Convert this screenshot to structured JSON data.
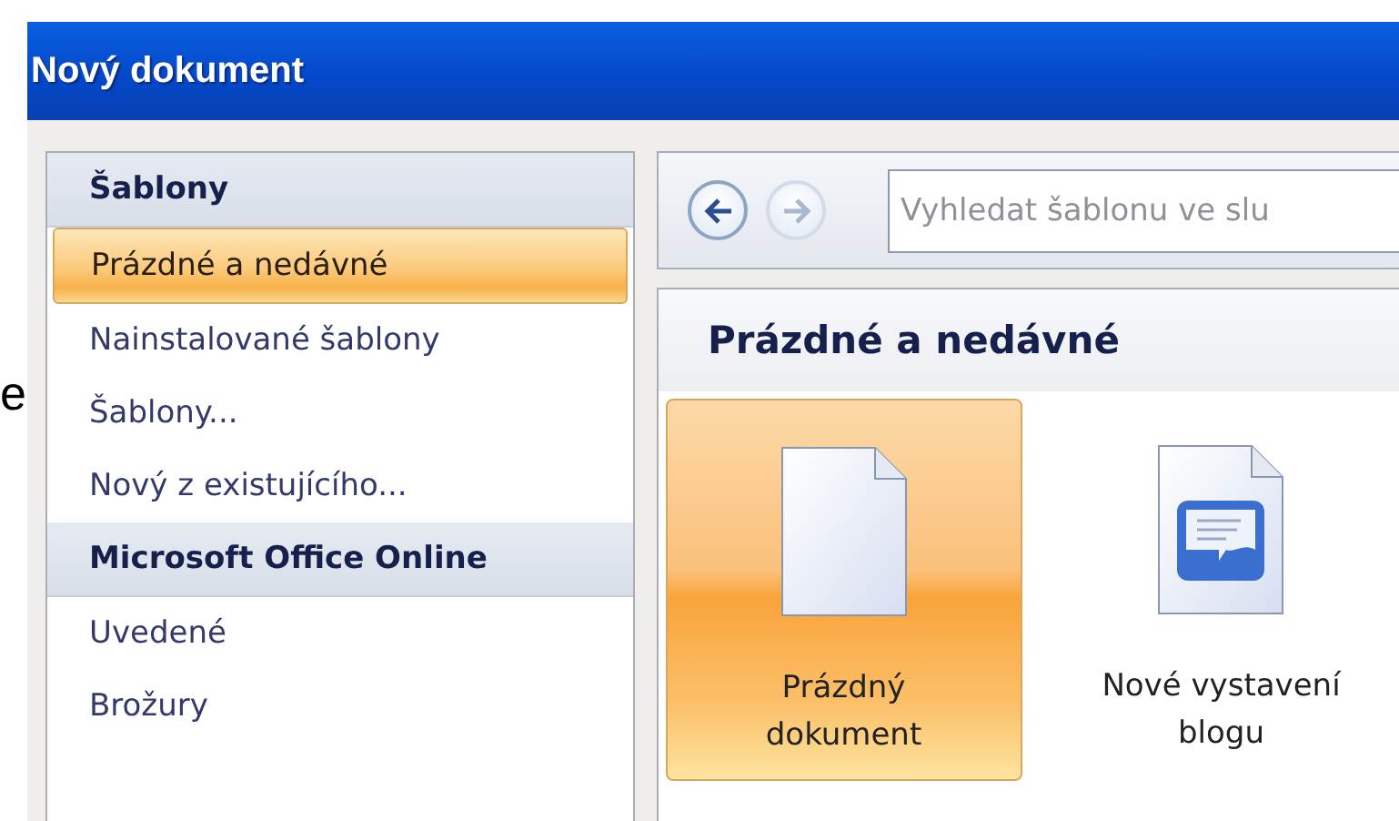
{
  "background_text": "e",
  "window": {
    "title": "Nový dokument"
  },
  "sidebar": {
    "items": [
      {
        "label": "Šablony",
        "kind": "header",
        "selected": false
      },
      {
        "label": "Prázdné a nedávné",
        "kind": "item",
        "selected": true
      },
      {
        "label": "Nainstalované šablony",
        "kind": "item",
        "selected": false
      },
      {
        "label": "Šablony...",
        "kind": "item",
        "selected": false
      },
      {
        "label": "Nový z existujícího...",
        "kind": "item",
        "selected": false
      },
      {
        "label": "Microsoft Office Online",
        "kind": "header",
        "selected": false
      },
      {
        "label": "Uvedené",
        "kind": "item",
        "selected": false
      },
      {
        "label": "Brožury",
        "kind": "item",
        "selected": false
      }
    ]
  },
  "toolbar": {
    "back": {
      "disabled": false
    },
    "forward": {
      "disabled": true
    },
    "search": {
      "placeholder": "Vyhledat šablonu ve slu"
    }
  },
  "section": {
    "title": "Prázdné a nedávné",
    "tiles": [
      {
        "label": "Prázdný\ndokument",
        "kind": "blank",
        "selected": true
      },
      {
        "label": "Nové vystavení\nblogu",
        "kind": "blog",
        "selected": false
      }
    ]
  }
}
